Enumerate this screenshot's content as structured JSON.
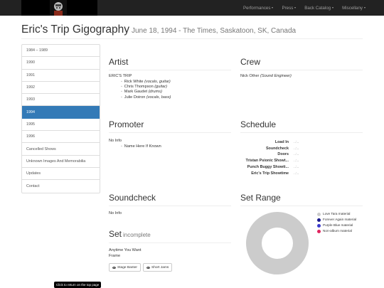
{
  "navbar": {
    "menu": [
      "Performances",
      "Press",
      "Back Catalog",
      "Miscellany"
    ]
  },
  "page": {
    "title": "Eric's Trip Gigography",
    "subtitle": "June 18, 1994 - The Times, Saskatoon, SK, Canada"
  },
  "sidebar": {
    "items": [
      "1984 – 1989",
      "1990",
      "1991",
      "1992",
      "1993",
      "1994",
      "1995",
      "1996",
      "Cancelled Shows",
      "Unknown Images And Memorabilia",
      "Updates",
      "Contact"
    ],
    "active_index": 5
  },
  "artist": {
    "heading": "Artist",
    "band": "ERIC'S TRIP",
    "members": [
      {
        "name": "Rick White",
        "role": "(vocals, guitar)"
      },
      {
        "name": "Chris Thompson",
        "role": "(guitar)"
      },
      {
        "name": "Mark Gaudet",
        "role": "(drums)"
      },
      {
        "name": "Julie Doiron",
        "role": "(vocals, bass)"
      }
    ]
  },
  "crew": {
    "heading": "Crew",
    "name": "Nick Other",
    "role": "(Sound Engineer)"
  },
  "promoter": {
    "heading": "Promoter",
    "info": "No Info",
    "item": "Name Here If Known"
  },
  "schedule": {
    "heading": "Schedule",
    "rows": [
      {
        "label": "Load In",
        "value": "..:.."
      },
      {
        "label": "Soundcheck",
        "value": "..:.."
      },
      {
        "label": "Doors",
        "value": "..:.."
      },
      {
        "label": "Tristan Psionic Showt...",
        "value": "..:.."
      },
      {
        "label": "Punch Buggy Showti...",
        "value": "..:.."
      },
      {
        "label": "Eric's Trip Showtime",
        "value": "..:.."
      }
    ]
  },
  "soundcheck": {
    "heading": "Soundcheck",
    "info": "No Info"
  },
  "set": {
    "heading": "Set",
    "status": "incomplete",
    "songs": [
      "Anytime You Want",
      "Frame"
    ],
    "buttons": [
      "Stage Banter",
      "Short Jams"
    ]
  },
  "set_range": {
    "heading": "Set Range",
    "legend": [
      {
        "label": "Love Tara material",
        "color": "#cccccc"
      },
      {
        "label": "Forever Again material",
        "color": "#1a1a8c"
      },
      {
        "label": "Purple Blue material",
        "color": "#3a3acc"
      },
      {
        "label": "Non-album material",
        "color": "#e0245e"
      }
    ],
    "slices": [
      100,
      0,
      0,
      0
    ]
  },
  "tooltip": "Click to return on the top page"
}
